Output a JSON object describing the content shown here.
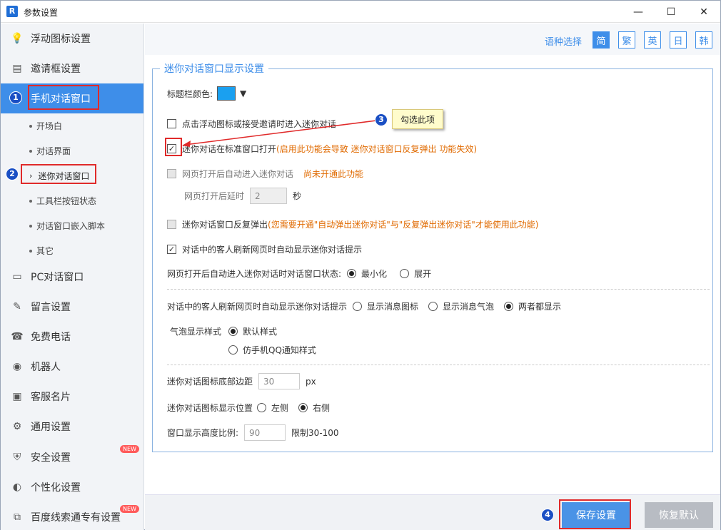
{
  "window": {
    "title": "参数设置",
    "minimize": "—",
    "maximize": "☐",
    "close": "✕"
  },
  "sidebar": {
    "items": [
      {
        "label": "浮动图标设置",
        "icon": "bulb-icon",
        "glyph": "💡"
      },
      {
        "label": "邀请框设置",
        "icon": "document-icon",
        "glyph": "▤"
      },
      {
        "label": "手机对话窗口",
        "icon": "phone-icon",
        "glyph": ""
      },
      {
        "label": "PC对话窗口",
        "icon": "monitor-icon",
        "glyph": "▭"
      },
      {
        "label": "留言设置",
        "icon": "message-icon",
        "glyph": "✎"
      },
      {
        "label": "免费电话",
        "icon": "telephone-icon",
        "glyph": "☎"
      },
      {
        "label": "机器人",
        "icon": "robot-icon",
        "glyph": "◉"
      },
      {
        "label": "客服名片",
        "icon": "card-icon",
        "glyph": "▣"
      },
      {
        "label": "通用设置",
        "icon": "gear-icon",
        "glyph": "⚙"
      },
      {
        "label": "安全设置",
        "icon": "shield-icon",
        "glyph": "⛨"
      },
      {
        "label": "个性化设置",
        "icon": "palette-icon",
        "glyph": "◐"
      },
      {
        "label": "百度线索通专有设置",
        "icon": "link-icon",
        "glyph": "⧉"
      }
    ],
    "subitems": [
      "开场白",
      "对话界面",
      "迷你对话窗口",
      "工具栏按钮状态",
      "对话窗口嵌入脚本",
      "其它"
    ],
    "new_badge": "NEW"
  },
  "lang": {
    "label": "语种选择",
    "options": [
      "简",
      "繁",
      "英",
      "日",
      "韩"
    ]
  },
  "panel": {
    "title": "迷你对话窗口显示设置",
    "title_color_label": "标题栏颜色:",
    "opt1": "点击浮动图标或接受邀请时进入迷你对话",
    "opt2": "迷你对话在标准窗口打开",
    "opt2_note": "(启用此功能会导致 迷你对话窗口反复弹出 功能失效)",
    "opt3": "网页打开后自动进入迷你对话",
    "opt3_note": "尚未开通此功能",
    "delay_label": "网页打开后延时",
    "delay_value": "2",
    "delay_unit": "秒",
    "opt4": "迷你对话窗口反复弹出",
    "opt4_note": "(您需要开通\"自动弹出迷你对话\"与\"反复弹出迷你对话\"才能使用此功能)",
    "opt5": "对话中的客人刷新网页时自动显示迷你对话提示",
    "state_label": "网页打开后自动进入迷你对话时对话窗口状态:",
    "state_min": "最小化",
    "state_expand": "展开",
    "refresh_label": "对话中的客人刷新网页时自动显示迷你对话提示",
    "refresh_icon": "显示消息图标",
    "refresh_bubble": "显示消息气泡",
    "refresh_both": "两者都显示",
    "bubble_label": "气泡显示样式",
    "bubble_default": "默认样式",
    "bubble_qq": "仿手机QQ通知样式",
    "margin_label": "迷你对话图标底部边距",
    "margin_value": "30",
    "margin_unit": "px",
    "pos_label": "迷你对话图标显示位置",
    "pos_left": "左侧",
    "pos_right": "右侧",
    "height_label": "窗口显示高度比例:",
    "height_value": "90",
    "height_note": "限制30-100"
  },
  "annot": {
    "n1": "1",
    "n2": "2",
    "n3": "3",
    "n4": "4",
    "tip": "勾选此项"
  },
  "footer": {
    "save": "保存设置",
    "reset": "恢复默认"
  },
  "colors": {
    "accent": "#3e8ee9",
    "swatch": "#1aa0f0",
    "annot_red": "#e02a2a"
  }
}
